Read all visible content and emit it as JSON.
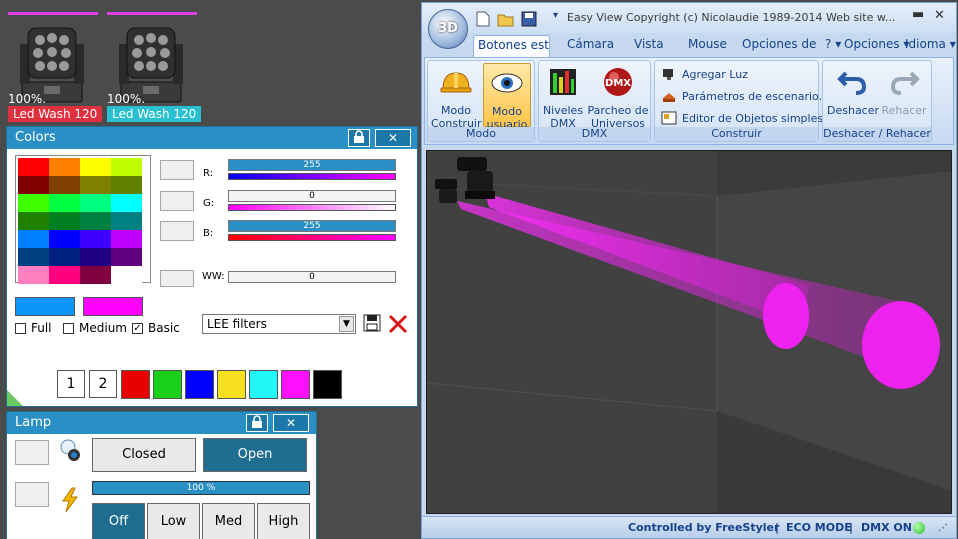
{
  "fixtures": [
    {
      "percent": "100%.",
      "name": "Led Wash 120",
      "tag_color": "#e03040"
    },
    {
      "percent": "100%.",
      "name": "Led Wash 120",
      "tag_color": "#28c0d0"
    }
  ],
  "colors_panel": {
    "title": "Colors",
    "close_label": "✕",
    "palette": [
      "#ff0000",
      "#ff8000",
      "#ffff00",
      "#c0ff00",
      "#800000",
      "#804000",
      "#808000",
      "#608000",
      "#40ff00",
      "#00ff40",
      "#00ff80",
      "#00ffff",
      "#208000",
      "#008020",
      "#008040",
      "#008080",
      "#0080ff",
      "#0000ff",
      "#4000ff",
      "#c000ff",
      "#004080",
      "#002080",
      "#200080",
      "#600080",
      "#ff80c0",
      "#ff0080",
      "#800040",
      "#ffffff"
    ],
    "channels": [
      {
        "label": "R:",
        "value": "255",
        "track_color": "#2a8fc4",
        "bar_gradient": "linear-gradient(90deg,#0000ff,#ff00ff)"
      },
      {
        "label": "G:",
        "value": "0",
        "track_color": "#f4f4f4",
        "bar_gradient": "linear-gradient(90deg,#ff00ff,#ffffff)"
      },
      {
        "label": "B:",
        "value": "255",
        "track_color": "#2a8fc4",
        "bar_gradient": "linear-gradient(90deg,#ff0000,#ff00ff)"
      },
      {
        "label": "WW:",
        "value": "0",
        "track_color": "#f4f4f4",
        "bar_gradient": ""
      }
    ],
    "preview_colors": [
      "#0a96f8",
      "#ff00ff"
    ],
    "checkboxes": [
      {
        "label": "Full",
        "checked": false
      },
      {
        "label": "Medium",
        "checked": false
      },
      {
        "label": "Basic",
        "checked": true
      }
    ],
    "filter_select": "LEE filters",
    "save_icon": "floppy-icon",
    "delete_icon": "red-x-icon",
    "preset_buttons": [
      "1",
      "2"
    ],
    "preset_colors": [
      "#e80000",
      "#18d018",
      "#0000ff",
      "#f8e020",
      "#20f8f8",
      "#ff10ff",
      "#000000"
    ]
  },
  "lamp_panel": {
    "title": "Lamp",
    "close_label": "✕",
    "closed_label": "Closed",
    "open_label": "Open",
    "intensity_percent": "100 %",
    "intensity_value": 100,
    "levels": [
      "Off",
      "Low",
      "Med",
      "High"
    ],
    "active_level": "Off"
  },
  "app": {
    "orb_label": "3D",
    "title": "Easy View   Copyright (c) Nicolaudie 1989-2014   Web site w...",
    "tabs": [
      {
        "label": "Botones están",
        "active": true
      },
      {
        "label": "Cámara",
        "active": false
      },
      {
        "label": "Vista",
        "active": false
      },
      {
        "label": "Mouse",
        "active": false
      },
      {
        "label": "Opciones de r",
        "active": false
      }
    ],
    "help_label": "?",
    "options_label": "Opciones",
    "language_label": "Idioma",
    "groups": {
      "modo": {
        "label": "Modo",
        "buttons": [
          {
            "label": "Modo\nConstruir",
            "icon": "hardhat-icon",
            "active": false
          },
          {
            "label": "Modo\nusuario",
            "icon": "eye-icon",
            "active": true
          }
        ]
      },
      "dmx": {
        "label": "DMX",
        "buttons": [
          {
            "label": "Niveles\nDMX",
            "icon": "levels-icon"
          },
          {
            "label": "Parcheo de\nUniversos",
            "icon": "dmx-ball-icon"
          }
        ]
      },
      "construir": {
        "label": "Construir",
        "items": [
          {
            "label": "Agregar Luz",
            "icon": "spotlight-icon"
          },
          {
            "label": "Parámetros de escenario...",
            "icon": "stage-icon"
          },
          {
            "label": "Editor de Objetos simples",
            "icon": "object-editor-icon"
          }
        ]
      },
      "deshacer": {
        "label": "Deshacer / Rehacer",
        "buttons": [
          {
            "label": "Deshacer",
            "icon": "undo-icon"
          },
          {
            "label": "Rehacer",
            "icon": "redo-icon"
          }
        ]
      }
    },
    "status": {
      "controlled": "Controlled by FreeStyler",
      "eco": "ECO MODE",
      "dmx": "DMX ON",
      "sep": "|"
    }
  }
}
